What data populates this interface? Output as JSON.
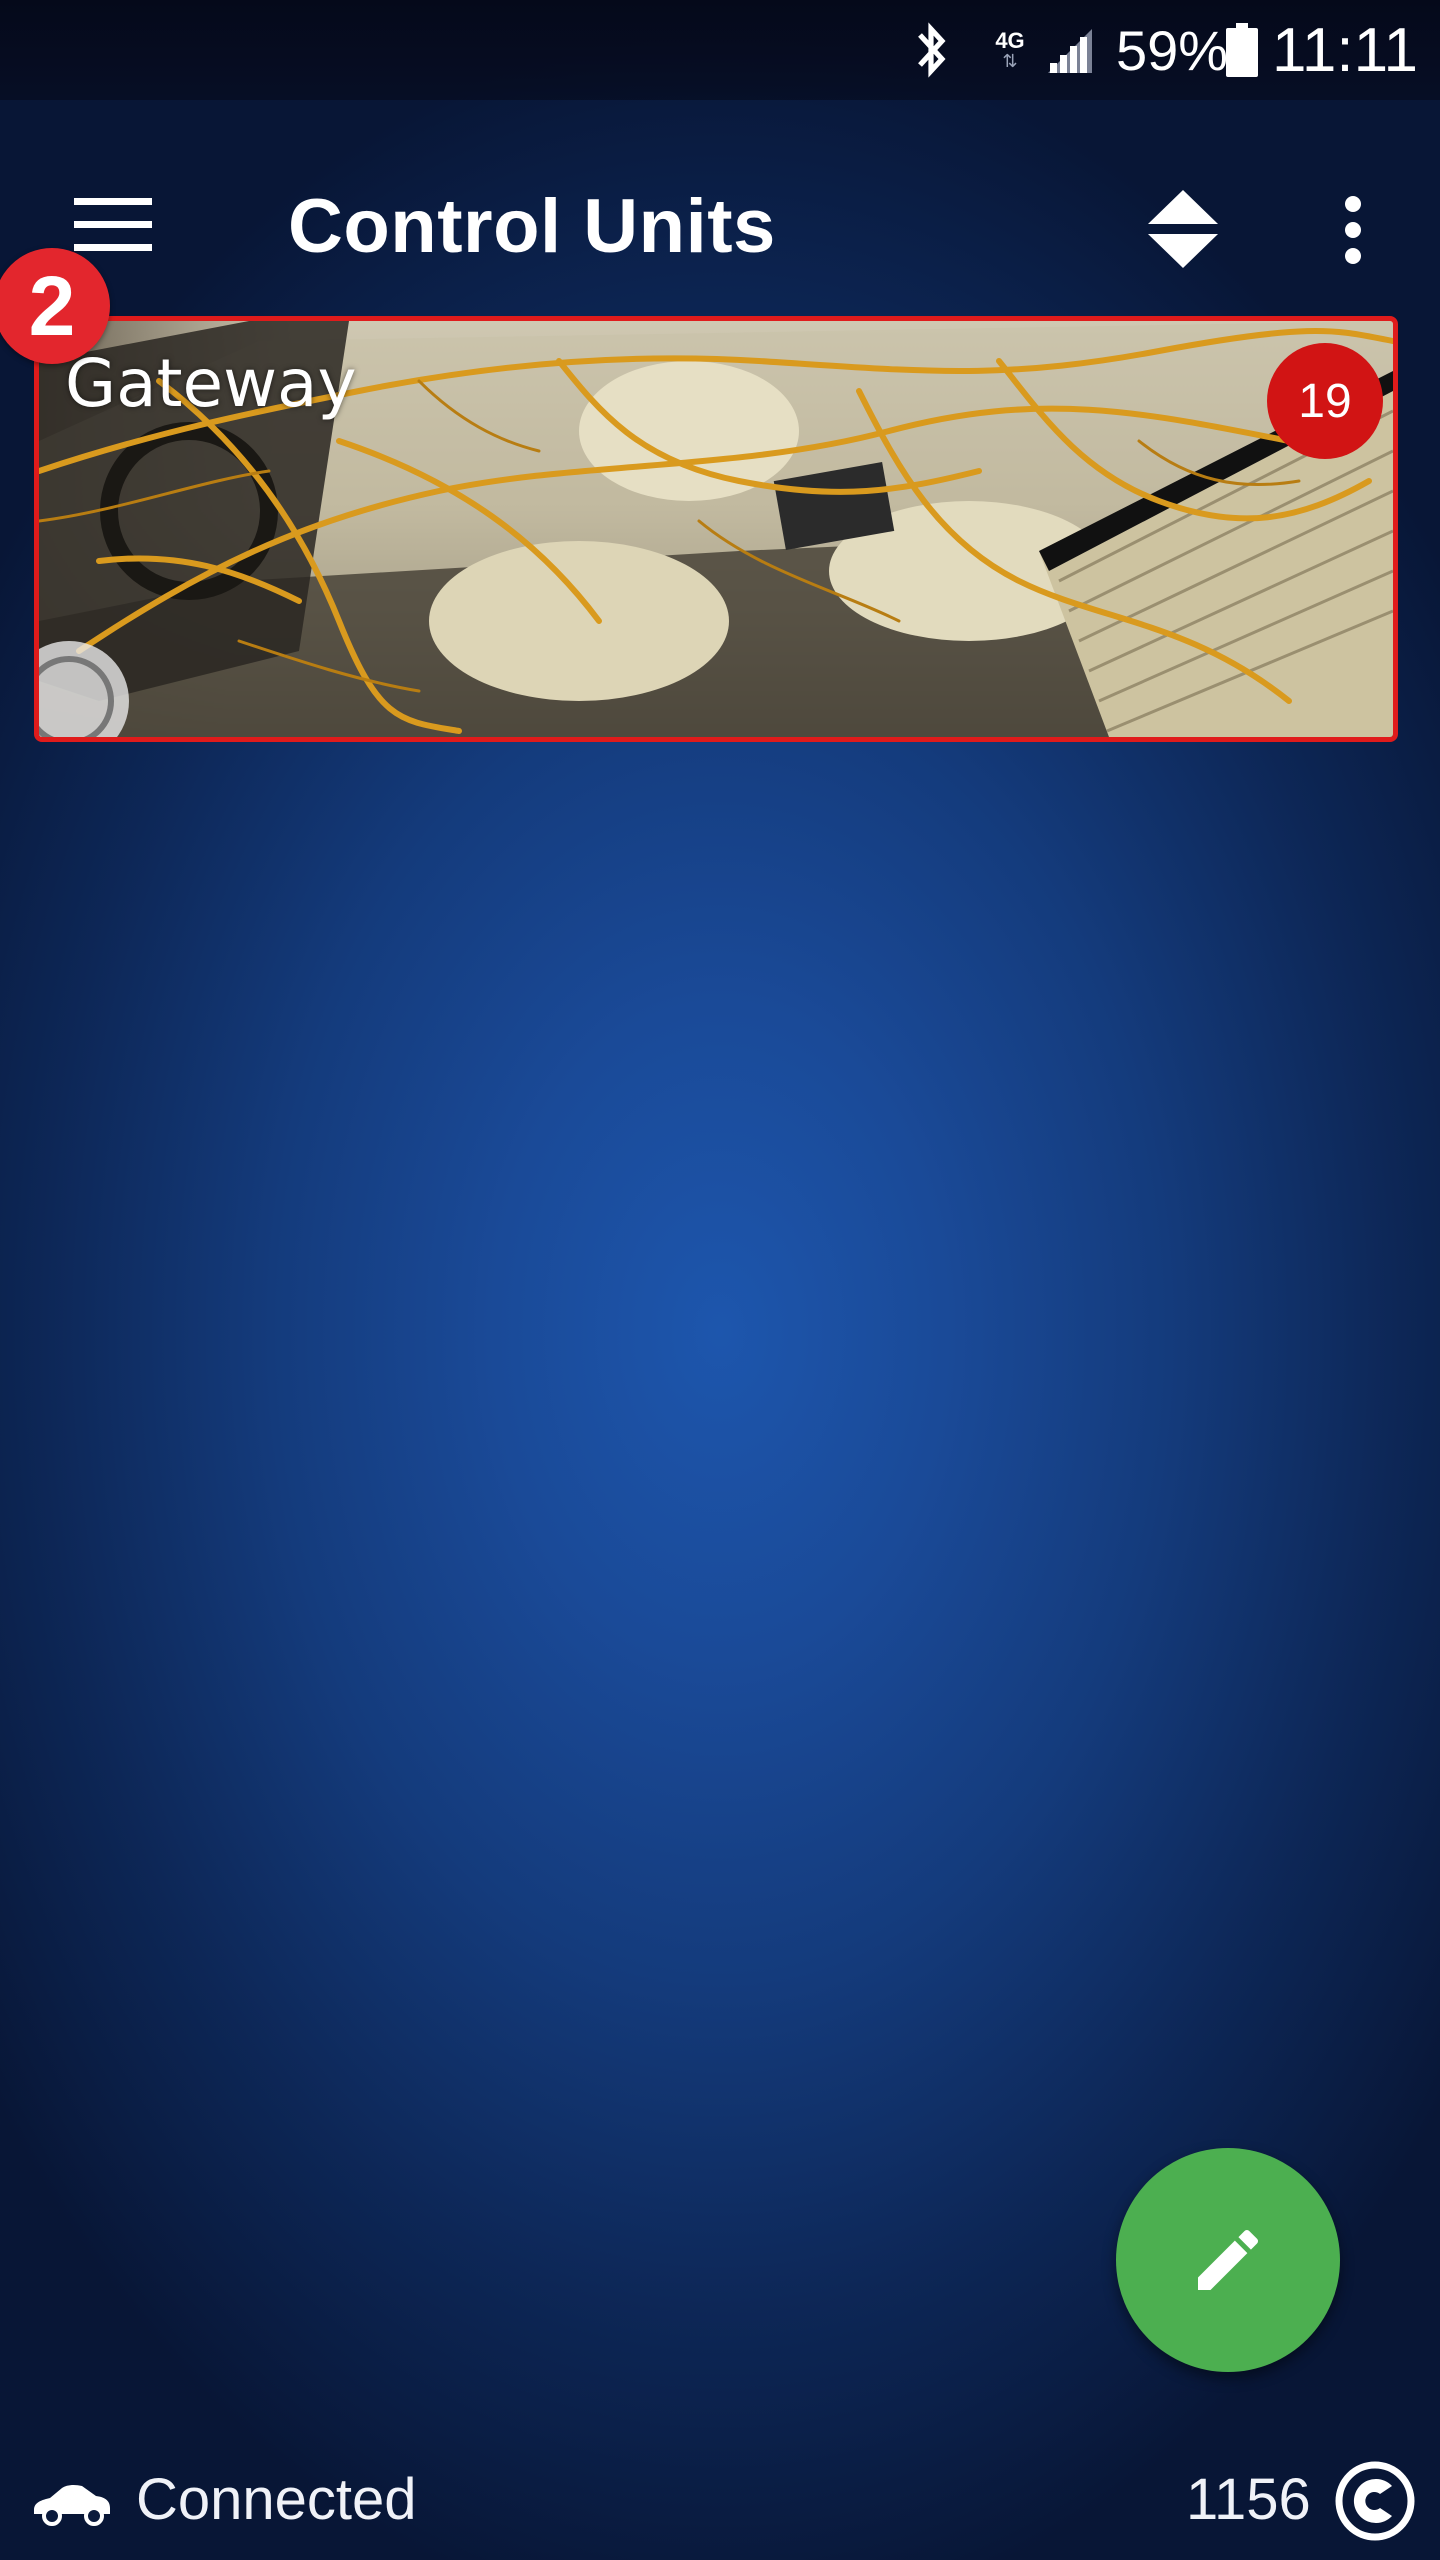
{
  "status_bar": {
    "network": "4G",
    "battery_percent": "59%",
    "time": "11:11",
    "icons": [
      "bluetooth-icon",
      "network-4g-icon",
      "signal-icon",
      "battery-icon"
    ]
  },
  "app_bar": {
    "title": "Control Units",
    "icons": [
      "menu-icon",
      "sort-icon",
      "more-vert-icon"
    ]
  },
  "units": [
    {
      "label": "Gateway",
      "count": "19"
    }
  ],
  "step_badge": "2",
  "fab": {
    "icon": "pencil-icon",
    "color": "#4caf50"
  },
  "bottom_bar": {
    "status": "Connected",
    "counter": "1156",
    "icons": [
      "car-icon",
      "brand-icon"
    ]
  },
  "colors": {
    "accent_red": "#e01b1b",
    "badge_red": "#d11414",
    "fab_green": "#4caf50",
    "background": "#1a4a98"
  }
}
